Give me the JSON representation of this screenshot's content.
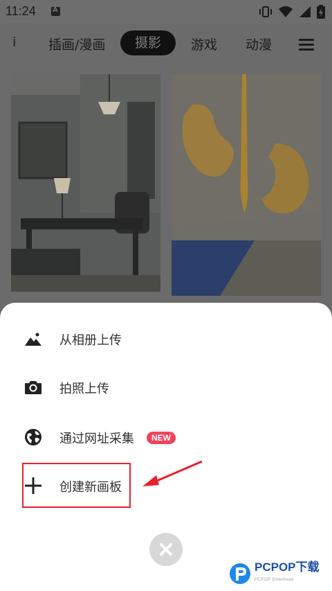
{
  "status_bar": {
    "time": "11:24",
    "icons": [
      "notification-a-icon",
      "vibrate-icon",
      "wifi-icon",
      "signal-icon",
      "battery-icon"
    ]
  },
  "tabs": {
    "partial_label": "i",
    "items": [
      {
        "label": "插画/漫画",
        "active": false
      },
      {
        "label": "摄影",
        "active": true
      },
      {
        "label": "游戏",
        "active": false
      },
      {
        "label": "动漫",
        "active": false
      }
    ],
    "menu_icon": "hamburger-menu-icon"
  },
  "cards": {
    "left_caption": "",
    "right_caption": ""
  },
  "sheet": {
    "options": [
      {
        "label": "从相册上传",
        "icon": "image-mountain-icon"
      },
      {
        "label": "拍照上传",
        "icon": "camera-icon"
      },
      {
        "label": "通过网址采集",
        "icon": "globe-icon",
        "badge": "NEW"
      },
      {
        "label": "创建新画板",
        "icon": "plus-icon"
      }
    ],
    "close_icon": "close-x-icon"
  },
  "watermark": {
    "brand": "PCPOP下载",
    "sub": "PCPOP Download"
  },
  "colors": {
    "badge": "#f0435b",
    "highlight": "#e8202a",
    "overlay": "#6b6b6b",
    "sheet": "#ffffff"
  }
}
